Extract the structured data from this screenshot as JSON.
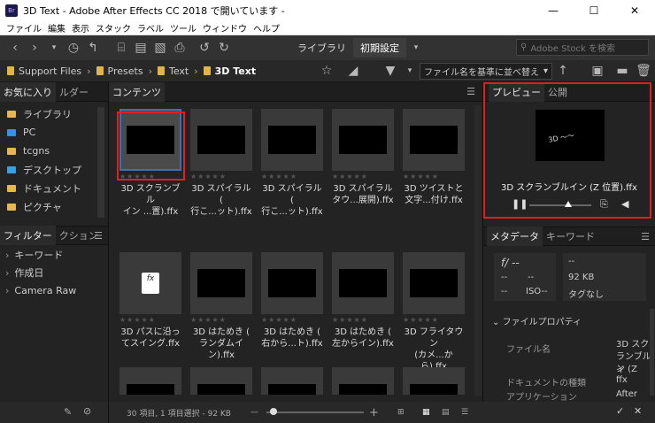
{
  "window": {
    "title": "3D Text - Adobe After Effects CC 2018 で開いています -",
    "app_icon": "Br",
    "minimize": "—",
    "maximize": "☐",
    "close": "✕"
  },
  "menu": [
    "ファイル",
    "編集",
    "表示",
    "スタック",
    "ラベル",
    "ツール",
    "ウィンドウ",
    "ヘルプ"
  ],
  "toolbar": {
    "library": "ライブラリ",
    "default": "初期設定",
    "stock_placeholder": "Adobe Stock を検索"
  },
  "path": [
    "Support Files",
    "Presets",
    "Text",
    "3D Text"
  ],
  "sort": "ファイル名を基準に並べ替え",
  "left_panel": {
    "tab_fav": "お気に入り",
    "tab_folder": "ルダー",
    "favorites": [
      {
        "label": "ライブラリ",
        "icon": "library-icon",
        "color": "#e6b84b"
      },
      {
        "label": "PC",
        "icon": "pc-icon",
        "color": "#3a8ee6"
      },
      {
        "label": "tcgns",
        "icon": "user-folder-icon",
        "color": "#e6b84b"
      },
      {
        "label": "デスクトップ",
        "icon": "desktop-icon",
        "color": "#3aa0e6"
      },
      {
        "label": "ドキュメント",
        "icon": "document-icon",
        "color": "#e6b84b"
      },
      {
        "label": "ピクチャ",
        "icon": "picture-icon",
        "color": "#e6b84b"
      }
    ],
    "tab_filter": "フィルター",
    "tab_collection": "クション",
    "filters": [
      "キーワード",
      "作成日",
      "Camera Raw"
    ]
  },
  "center": {
    "tab": "コンテンツ",
    "items": [
      {
        "name1": "3D スクランブル",
        "name2": "イン ...置).ffx"
      },
      {
        "name1": "3D スパイラル (",
        "name2": "行こ...ット).ffx"
      },
      {
        "name1": "3D スパイラル (",
        "name2": "行こ...ット).ffx"
      },
      {
        "name1": "3D スパイラル",
        "name2": "タウ...展開).ffx"
      },
      {
        "name1": "3D ツイストと",
        "name2": "文字...付け.ffx"
      },
      {
        "name1": "3D パスに沿っ",
        "name2": "てスイング.ffx"
      },
      {
        "name1": "3D はためき (",
        "name2": "ランダムイン).ffx"
      },
      {
        "name1": "3D はためき (",
        "name2": "右から...ト).ffx"
      },
      {
        "name1": "3D はためき (",
        "name2": "左からイン).ffx"
      },
      {
        "name1": "3D フライタウン",
        "name2": "(カメ...から).ffx"
      },
      {
        "name1": "",
        "name2": ""
      },
      {
        "name1": "",
        "name2": ""
      },
      {
        "name1": "",
        "name2": ""
      },
      {
        "name1": "",
        "name2": ""
      },
      {
        "name1": "",
        "name2": ""
      }
    ],
    "stars": "★★★★★",
    "status": "30 項目, 1 項目選択 - 92 KB"
  },
  "right_panel": {
    "tab_preview": "プレビュー",
    "tab_publish": "公開",
    "preview_name": "3D スクランブルイン (Z 位置).ffx",
    "tab_meta": "メタデータ",
    "tab_keyword": "キーワード",
    "meta_cells": [
      "f/ --",
      "--",
      "--",
      "--",
      "ISO--",
      "92 KB",
      "タグなし",
      "--"
    ],
    "file_props": "ファイルプロパティ",
    "props": [
      {
        "key": "ファイル名",
        "val": "3D スク"
      },
      {
        "key": "",
        "val": "ランブルイ"
      },
      {
        "key": "",
        "val": "ン (Z"
      },
      {
        "key": "ドキュメントの種類",
        "val": "ffx"
      },
      {
        "key": "アプリケーション",
        "val": "After"
      }
    ]
  }
}
